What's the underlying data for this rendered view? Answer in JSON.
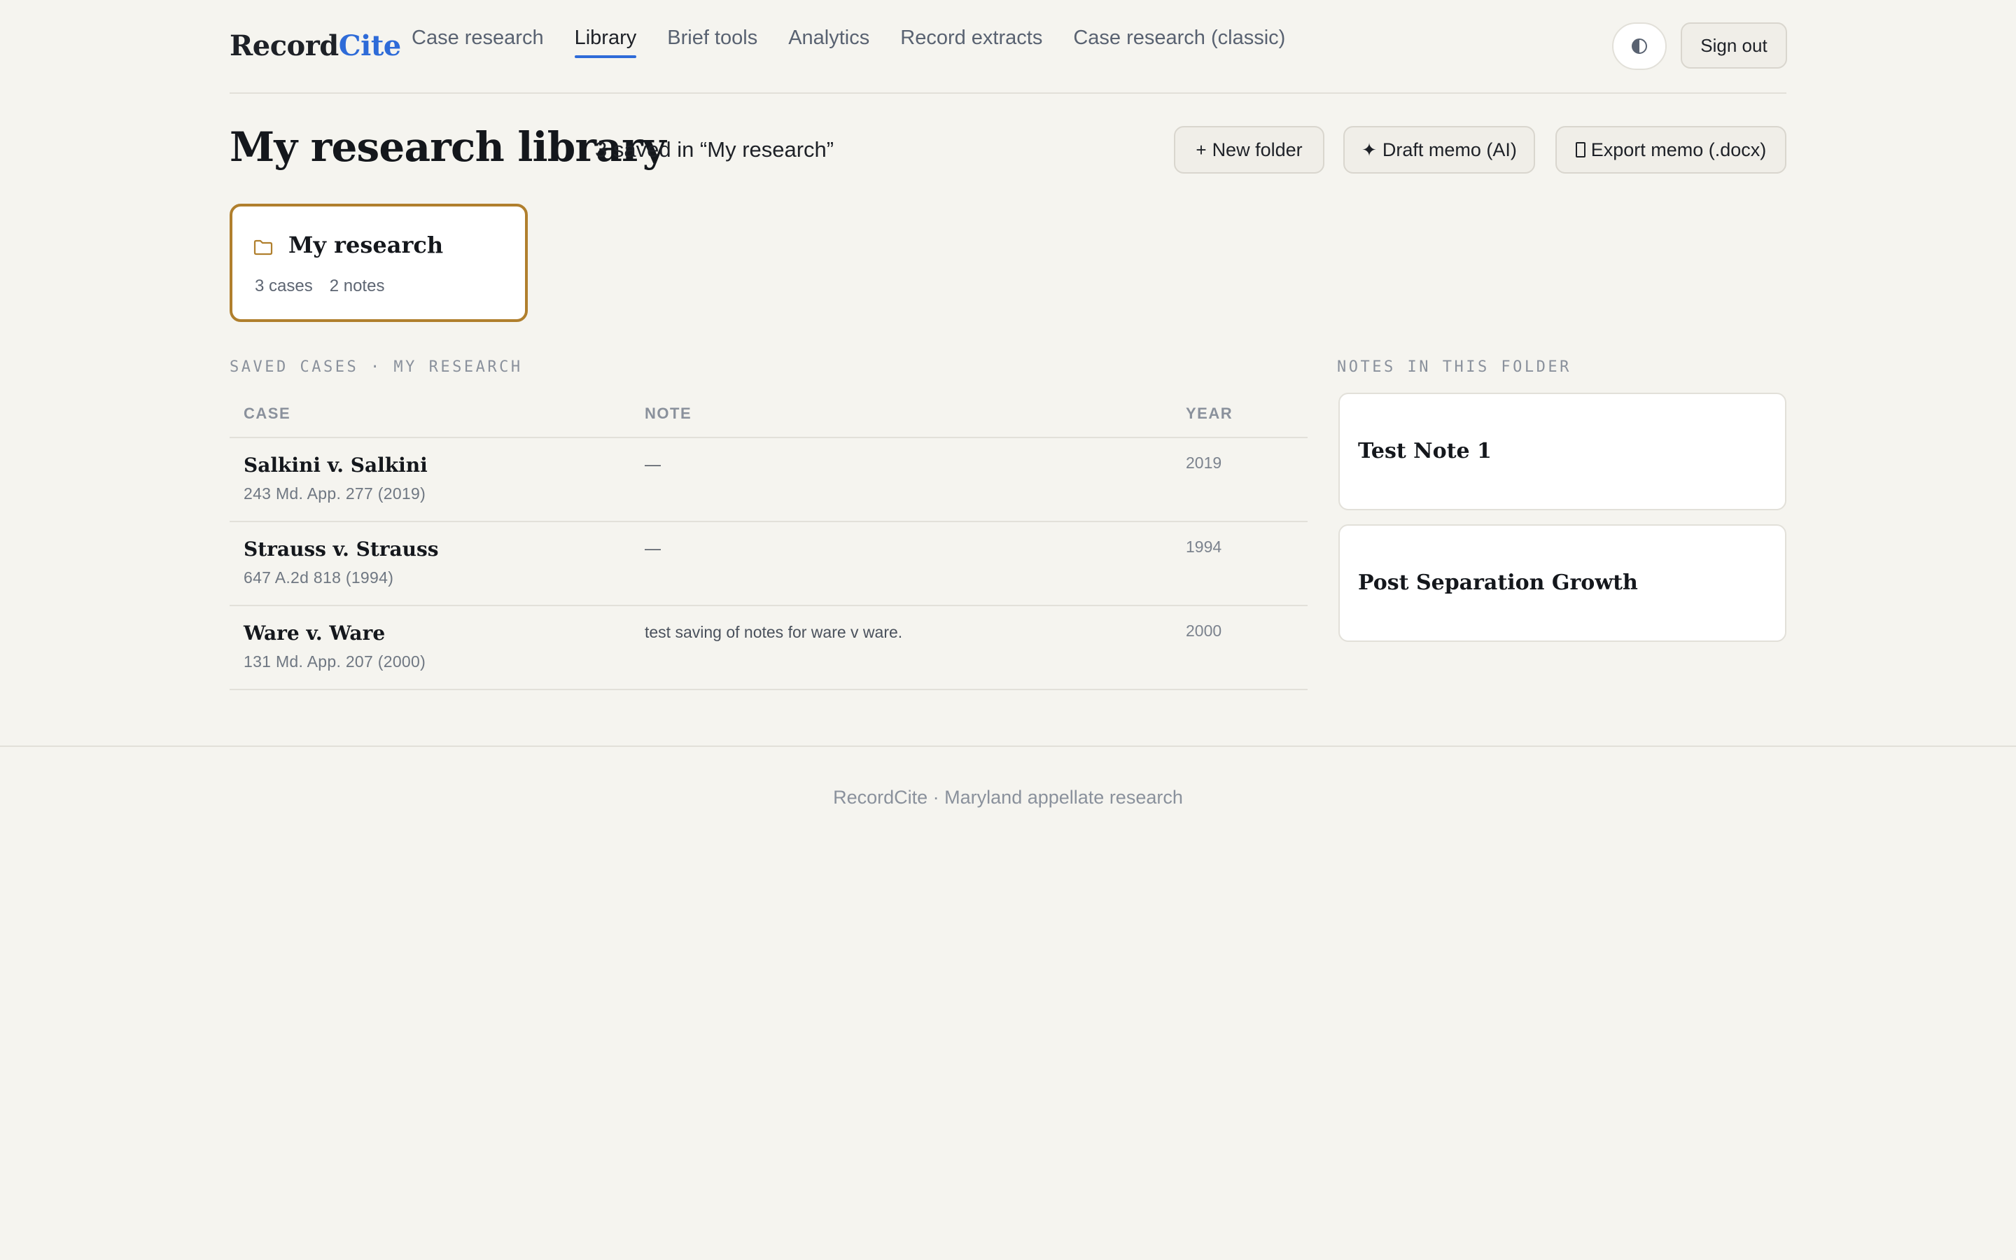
{
  "app": {
    "logo_primary": "Record",
    "logo_accent": "Cite",
    "accent_color": "#2e6bd8",
    "folder_color": "#b07f2d"
  },
  "nav": {
    "items": [
      {
        "label": "Case research",
        "active": false
      },
      {
        "label": "Library",
        "active": true
      },
      {
        "label": "Brief tools",
        "active": false
      },
      {
        "label": "Analytics",
        "active": false
      },
      {
        "label": "Record extracts",
        "active": false
      },
      {
        "label": "Case research (classic)",
        "active": false
      }
    ],
    "theme_icon": "contrast-icon",
    "sign_out_label": "Sign out"
  },
  "page": {
    "title": "My research library",
    "subtitle": "3 saved in “My research”"
  },
  "actions": {
    "new_folder": {
      "icon": "+",
      "label": "New folder"
    },
    "draft_memo": {
      "icon": "✦",
      "label": "Draft memo (AI)"
    },
    "export_memo": {
      "icon": "document-icon",
      "label": "Export memo (.docx)"
    }
  },
  "folder": {
    "icon": "folder-icon",
    "name": "My research",
    "cases_count": "3 cases",
    "notes_count": "2 notes"
  },
  "cases_section": {
    "label": "SAVED CASES · MY RESEARCH",
    "columns": [
      "CASE",
      "NOTE",
      "YEAR"
    ],
    "rows": [
      {
        "name": "Salkini v. Salkini",
        "citation": "243 Md. App. 277 (2019)",
        "note": "—",
        "year": "2019"
      },
      {
        "name": "Strauss v. Strauss",
        "citation": "647 A.2d 818 (1994)",
        "note": "—",
        "year": "1994"
      },
      {
        "name": "Ware v. Ware",
        "citation": "131 Md. App. 207 (2000)",
        "note": "test saving of notes for ware v ware.",
        "year": "2000"
      }
    ]
  },
  "notes_section": {
    "label": "NOTES IN THIS FOLDER",
    "notes": [
      {
        "title": "Test Note 1"
      },
      {
        "title": "Post Separation Growth"
      }
    ]
  },
  "footer": {
    "text": "RecordCite · Maryland appellate research"
  }
}
